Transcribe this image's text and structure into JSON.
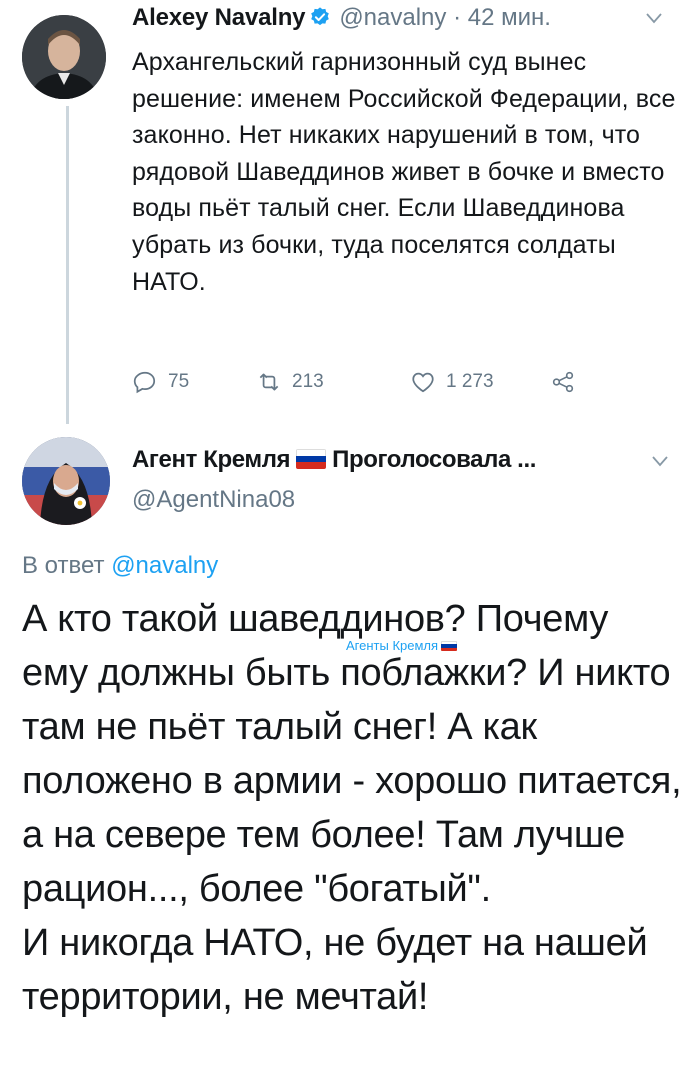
{
  "tweet1": {
    "author_name": "Alexey Navalny",
    "handle": "@navalny",
    "separator": "·",
    "time": "42 мин.",
    "text": "Архангельский гарнизонный суд вынес решение: именем Российской Федерации, все законно. Нет никаких нарушений в том, что рядовой Шаведдинов живет в бочке и вместо воды пьёт талый снег. Если Шаведдинова убрать из бочки, туда поселятся солдаты НАТО.",
    "replies": "75",
    "retweets": "213",
    "likes": "1 273"
  },
  "tweet2": {
    "author_name_part1": "Агент Кремля",
    "author_name_part2": "Проголосовала ...",
    "handle": "@AgentNina08",
    "reply_prefix": "В ответ",
    "reply_to": "@navalny",
    "text": "А кто такой шаведдинов? Почему ему должны быть поблажки? И никто там не пьёт талый снег! А как положено в армии - хорошо питается, а на севере тем более! Там лучше рацион..., более \"богатый\".\nИ никогда НАТО, не будет на нашей территории, не мечтай!",
    "watermark": "Агенты Кремля"
  },
  "colors": {
    "link": "#1da1f2",
    "muted": "#657786",
    "text": "#14171a",
    "thread_line": "#ccd6dd",
    "flag_white": "#ffffff",
    "flag_blue": "#0039a6",
    "flag_red": "#d52b1e"
  },
  "icons": {
    "verified": "verified-badge-icon",
    "caret": "chevron-down-icon",
    "reply": "reply-icon",
    "retweet": "retweet-icon",
    "like": "heart-icon",
    "share": "share-icon",
    "flag": "russian-flag-icon"
  }
}
